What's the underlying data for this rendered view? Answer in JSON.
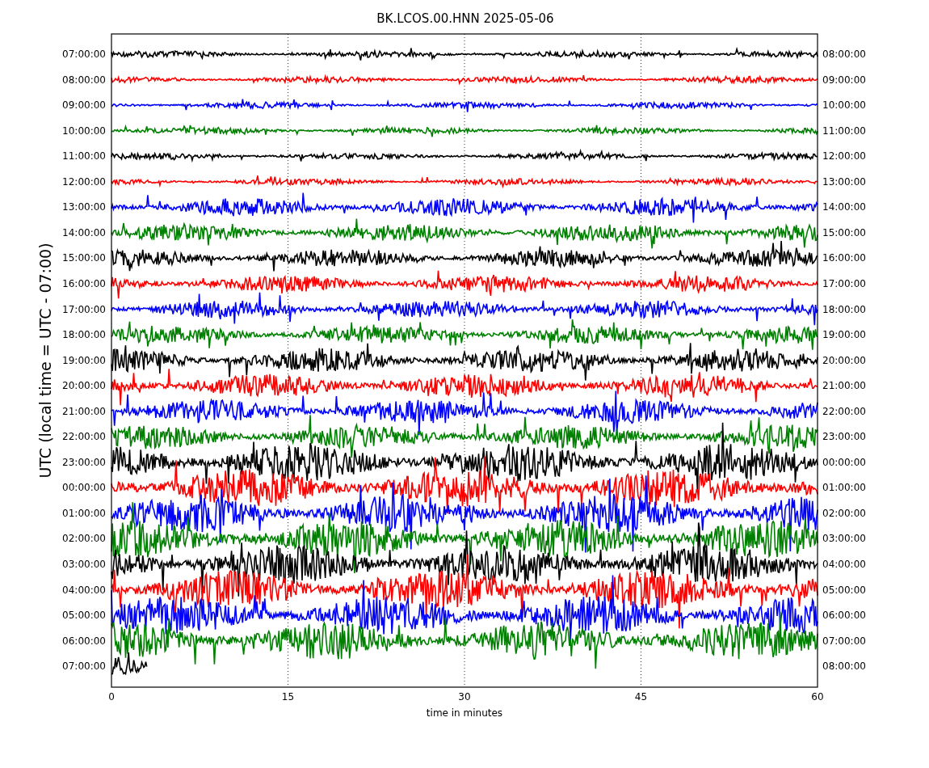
{
  "title": "BK.LCOS.00.HNN 2025-05-06",
  "ylabel": "UTC (local time = UTC - 07:00)",
  "xlabel": "time in minutes",
  "xticks": [
    "0",
    "15",
    "30",
    "45",
    "60"
  ],
  "rows": [
    {
      "left": "07:00:00",
      "right": "08:00:00",
      "color": "#000000"
    },
    {
      "left": "08:00:00",
      "right": "09:00:00",
      "color": "#ff0000"
    },
    {
      "left": "09:00:00",
      "right": "10:00:00",
      "color": "#0000ff"
    },
    {
      "left": "10:00:00",
      "right": "11:00:00",
      "color": "#008000"
    },
    {
      "left": "11:00:00",
      "right": "12:00:00",
      "color": "#000000"
    },
    {
      "left": "12:00:00",
      "right": "13:00:00",
      "color": "#ff0000"
    },
    {
      "left": "13:00:00",
      "right": "14:00:00",
      "color": "#0000ff"
    },
    {
      "left": "14:00:00",
      "right": "15:00:00",
      "color": "#008000"
    },
    {
      "left": "15:00:00",
      "right": "16:00:00",
      "color": "#000000"
    },
    {
      "left": "16:00:00",
      "right": "17:00:00",
      "color": "#ff0000"
    },
    {
      "left": "17:00:00",
      "right": "18:00:00",
      "color": "#0000ff"
    },
    {
      "left": "18:00:00",
      "right": "19:00:00",
      "color": "#008000"
    },
    {
      "left": "19:00:00",
      "right": "20:00:00",
      "color": "#000000"
    },
    {
      "left": "20:00:00",
      "right": "21:00:00",
      "color": "#ff0000"
    },
    {
      "left": "21:00:00",
      "right": "22:00:00",
      "color": "#0000ff"
    },
    {
      "left": "22:00:00",
      "right": "23:00:00",
      "color": "#008000"
    },
    {
      "left": "23:00:00",
      "right": "00:00:00",
      "color": "#000000"
    },
    {
      "left": "00:00:00",
      "right": "01:00:00",
      "color": "#ff0000"
    },
    {
      "left": "01:00:00",
      "right": "02:00:00",
      "color": "#0000ff"
    },
    {
      "left": "02:00:00",
      "right": "03:00:00",
      "color": "#008000"
    },
    {
      "left": "03:00:00",
      "right": "04:00:00",
      "color": "#000000"
    },
    {
      "left": "04:00:00",
      "right": "05:00:00",
      "color": "#ff0000"
    },
    {
      "left": "05:00:00",
      "right": "06:00:00",
      "color": "#0000ff"
    },
    {
      "left": "06:00:00",
      "right": "07:00:00",
      "color": "#008000"
    },
    {
      "left": "07:00:00",
      "right": "08:00:00",
      "color": "#000000"
    }
  ]
}
